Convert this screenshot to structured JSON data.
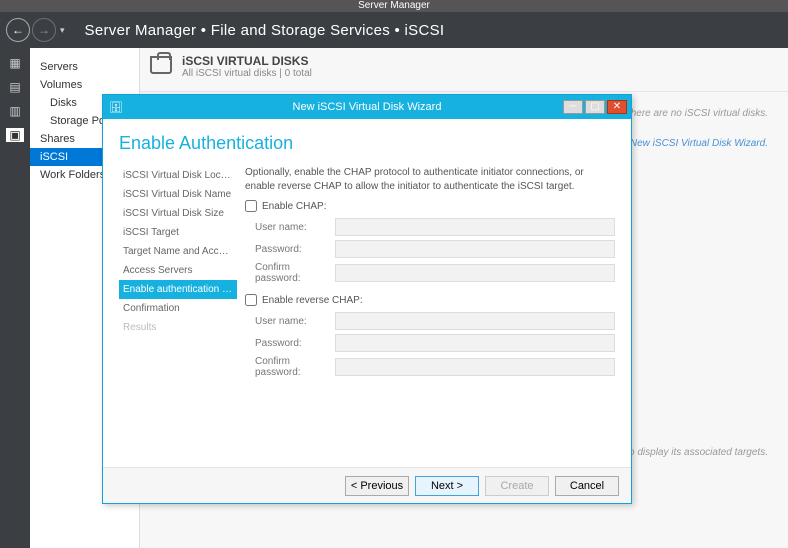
{
  "window": {
    "title": "Server Manager"
  },
  "breadcrumb": "Server Manager • File and Storage Services • iSCSI",
  "sidenav": {
    "items": [
      {
        "label": "Servers",
        "sub": false
      },
      {
        "label": "Volumes",
        "sub": false
      },
      {
        "label": "Disks",
        "sub": true
      },
      {
        "label": "Storage Po…",
        "sub": true
      },
      {
        "label": "Shares",
        "sub": false
      },
      {
        "label": "iSCSI",
        "sub": false,
        "selected": true
      },
      {
        "label": "Work Folders",
        "sub": false
      }
    ]
  },
  "panel": {
    "title": "iSCSI VIRTUAL DISKS",
    "subtitle": "All iSCSI virtual disks | 0 total",
    "hint_none": "There are no iSCSI virtual disks.",
    "hint_create": "disk, start the New iSCSI Virtual Disk Wizard.",
    "hint_target": "VHD to display its associated targets."
  },
  "wizard": {
    "title": "New iSCSI Virtual Disk Wizard",
    "heading": "Enable Authentication",
    "description": "Optionally, enable the CHAP protocol to authenticate initiator connections, or enable reverse CHAP to allow the initiator to authenticate the iSCSI target.",
    "steps": [
      "iSCSI Virtual Disk Location",
      "iSCSI Virtual Disk Name",
      "iSCSI Virtual Disk Size",
      "iSCSI Target",
      "Target Name and Access",
      "Access Servers",
      "Enable authentication ser…",
      "Confirmation",
      "Results"
    ],
    "selected_step_index": 6,
    "disabled_step_index": 8,
    "chap": {
      "label": "Enable CHAP:",
      "user_label": "User name:",
      "pass_label": "Password:",
      "confirm_label": "Confirm password:"
    },
    "rchap": {
      "label": "Enable reverse CHAP:",
      "user_label": "User name:",
      "pass_label": "Password:",
      "confirm_label": "Confirm password:"
    },
    "buttons": {
      "prev": "< Previous",
      "next": "Next >",
      "create": "Create",
      "cancel": "Cancel"
    }
  }
}
